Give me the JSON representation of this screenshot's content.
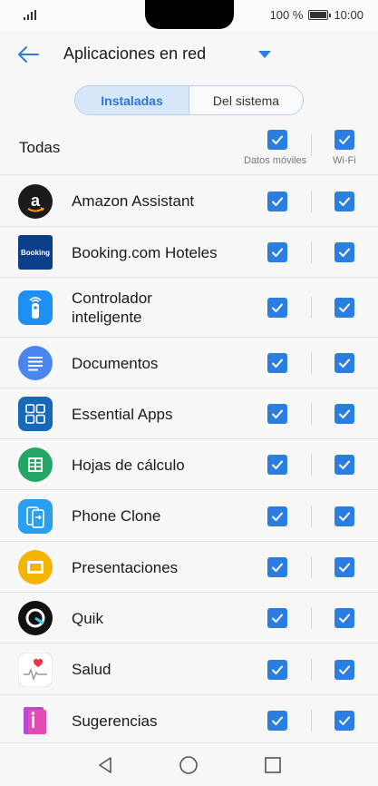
{
  "status_bar": {
    "battery_text": "100 %",
    "time": "10:00",
    "battery_level": 1.0
  },
  "app_bar": {
    "title": "Aplicaciones en red"
  },
  "tabs": [
    {
      "label": "Instaladas",
      "active": true
    },
    {
      "label": "Del sistema",
      "active": false
    }
  ],
  "header": {
    "all_label": "Todas",
    "col_mobile_label": "Datos móviles",
    "col_wifi_label": "Wi-Fi",
    "mobile_checked": true,
    "wifi_checked": true
  },
  "apps": [
    {
      "name": "Amazon Assistant",
      "icon": "amazon-assistant-icon",
      "mobile": true,
      "wifi": true
    },
    {
      "name": "Booking.com Hoteles",
      "icon": "booking-icon",
      "icon_text": "Booking",
      "mobile": true,
      "wifi": true
    },
    {
      "name": "Controlador\ninteligente",
      "icon": "smart-remote-icon",
      "mobile": true,
      "wifi": true
    },
    {
      "name": "Documentos",
      "icon": "docs-icon",
      "mobile": true,
      "wifi": true
    },
    {
      "name": "Essential Apps",
      "icon": "essential-apps-icon",
      "mobile": true,
      "wifi": true
    },
    {
      "name": "Hojas de cálculo",
      "icon": "sheets-icon",
      "mobile": true,
      "wifi": true
    },
    {
      "name": "Phone Clone",
      "icon": "phone-clone-icon",
      "mobile": true,
      "wifi": true
    },
    {
      "name": "Presentaciones",
      "icon": "slides-icon",
      "mobile": true,
      "wifi": true
    },
    {
      "name": "Quik",
      "icon": "quik-icon",
      "mobile": true,
      "wifi": true
    },
    {
      "name": "Salud",
      "icon": "health-icon",
      "mobile": true,
      "wifi": true
    },
    {
      "name": "Sugerencias",
      "icon": "tips-icon",
      "mobile": true,
      "wifi": true
    }
  ],
  "colors": {
    "accent": "#2a7de1",
    "tab_active_bg": "#d7e6f8",
    "background": "#f7f7f7"
  },
  "nav": {
    "back": "nav-back-icon",
    "home": "nav-home-icon",
    "recents": "nav-recents-icon"
  }
}
